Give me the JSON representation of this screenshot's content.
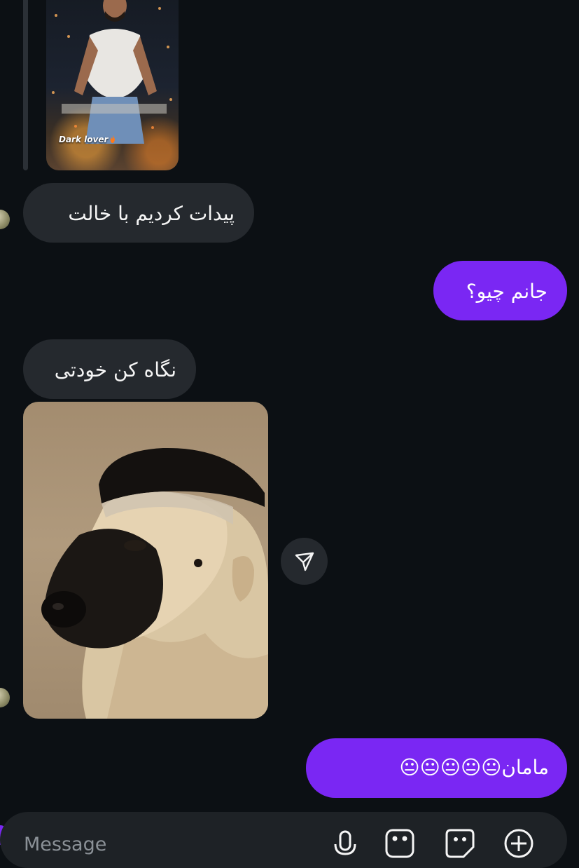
{
  "story": {
    "caption": "Dark lover"
  },
  "messages": [
    {
      "id": "found",
      "direction": "incoming",
      "text": "پیدات کردیم با خالت"
    },
    {
      "id": "what",
      "direction": "outgoing",
      "text": "جانم چیو؟"
    },
    {
      "id": "look",
      "direction": "incoming",
      "text": "نگاه کن خودتی"
    },
    {
      "id": "mom",
      "direction": "outgoing",
      "text": "مامان😐😐😐😐😐"
    }
  ],
  "composer": {
    "placeholder": "Message"
  },
  "colors": {
    "background": "#0c1014",
    "incoming_bubble": "#25292e",
    "outgoing_bubble": "#7a27f3"
  }
}
